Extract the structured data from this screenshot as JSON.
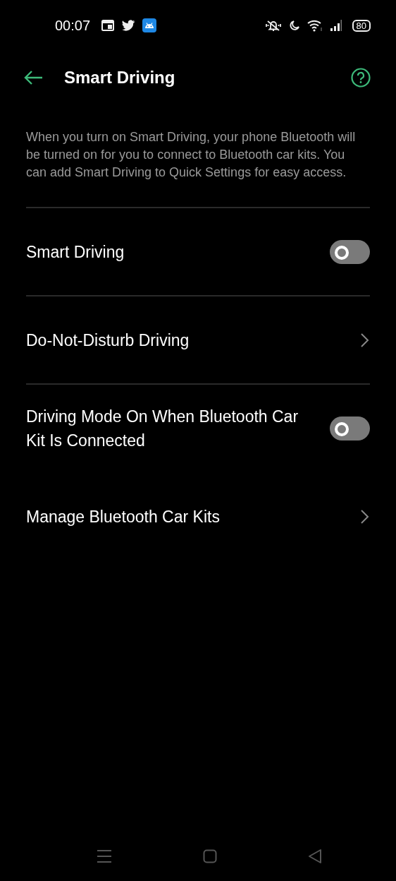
{
  "status_bar": {
    "time": "00:07",
    "battery": "80"
  },
  "header": {
    "title": "Smart Driving"
  },
  "description": "When you turn on Smart Driving, your phone Bluetooth will be turned on for you to connect to Bluetooth car kits. You can add Smart Driving to Quick Settings for easy access.",
  "settings": [
    {
      "kind": "toggle",
      "label": "Smart Driving",
      "on": false,
      "divider": true
    },
    {
      "kind": "link",
      "label": "Do-Not-Disturb Driving",
      "divider": true
    },
    {
      "kind": "toggle",
      "label": "Driving Mode On When Bluetooth Car Kit Is Connected",
      "on": false,
      "divider": false
    },
    {
      "kind": "link",
      "label": "Manage Bluetooth Car Kits",
      "divider": false
    }
  ]
}
